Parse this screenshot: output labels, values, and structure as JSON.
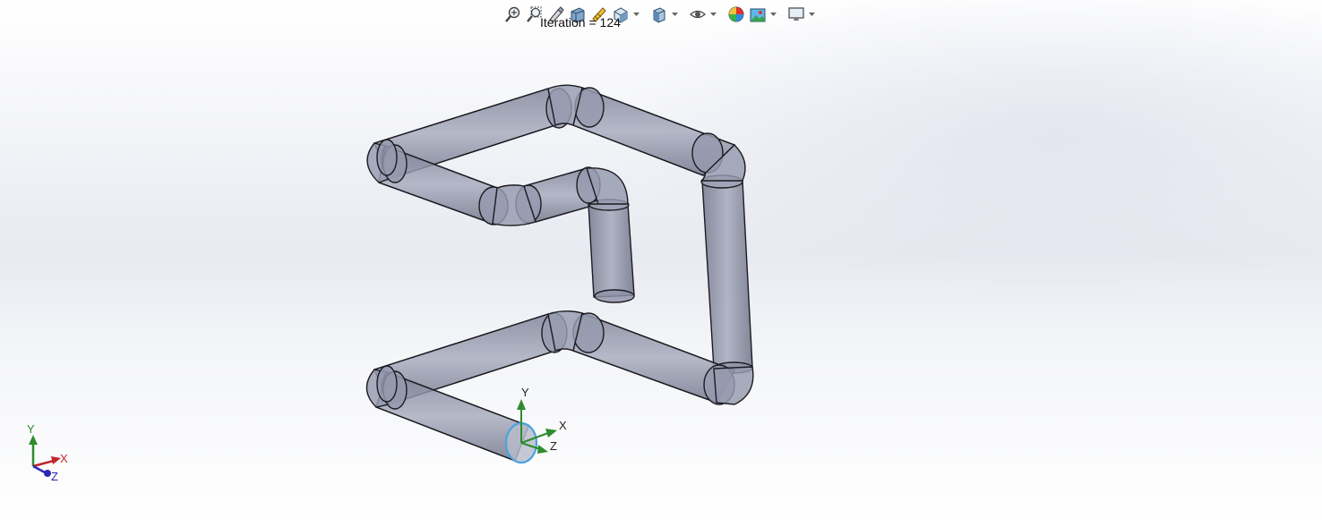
{
  "status": {
    "iteration_text": "Iteration = 124"
  },
  "toolbar": {
    "buttons": [
      {
        "name": "zoom-to-fit",
        "icon": "zoom-fit-icon"
      },
      {
        "name": "zoom-to-area",
        "icon": "zoom-area-icon"
      },
      {
        "name": "previous-view",
        "icon": "previous-view-icon"
      },
      {
        "name": "section-view",
        "icon": "section-view-icon"
      },
      {
        "name": "dynamic-annotation-views",
        "icon": "annotation-view-icon"
      },
      {
        "name": "view-orientation",
        "icon": "view-orientation-icon"
      },
      {
        "name": "display-style",
        "icon": "display-style-icon"
      },
      {
        "name": "hide-show-items",
        "icon": "hide-show-eye-icon"
      },
      {
        "name": "edit-appearance",
        "icon": "appearance-icon"
      },
      {
        "name": "apply-scene",
        "icon": "scene-icon"
      },
      {
        "name": "view-settings",
        "icon": "monitor-icon"
      }
    ]
  },
  "triad": {
    "x_label": "X",
    "y_label": "Y",
    "z_label": "Z"
  },
  "reference_triad": {
    "x_label": "X",
    "y_label": "Y",
    "z_label": "Z"
  },
  "colors": {
    "tube_fill": "#8a8ea3",
    "tube_edge": "#1c1c22",
    "axis_x": "#c0272d",
    "axis_y": "#2e8b2e",
    "axis_z": "#2a2ab0",
    "selected_face": "#4aa3df"
  }
}
